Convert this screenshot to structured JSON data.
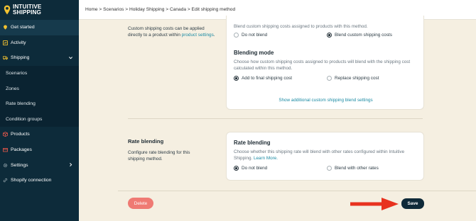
{
  "brand": {
    "line1": "INTUITIVE",
    "line2": "SHIPPING"
  },
  "colors": {
    "sidebar": "#0d2b3a",
    "accent_link": "#1a8aa3",
    "delete": "#ef7a73",
    "save": "#0f2a39",
    "arrow": "#e8321e",
    "background": "#f5efe1"
  },
  "breadcrumb": "Home > Scenarios > Holiday Shipping > Canada > Edit shipping method",
  "sidebar": {
    "items": [
      {
        "label": "Get started",
        "icon": "pin-icon"
      },
      {
        "label": "Activity",
        "icon": "activity-icon"
      },
      {
        "label": "Shipping",
        "icon": "truck-icon"
      },
      {
        "label": "Scenarios"
      },
      {
        "label": "Zones"
      },
      {
        "label": "Rate blending"
      },
      {
        "label": "Condition groups"
      },
      {
        "label": "Products",
        "icon": "box-icon"
      },
      {
        "label": "Packages",
        "icon": "package-icon"
      },
      {
        "label": "Settings",
        "icon": "gear-icon"
      },
      {
        "label": "Shopify connection",
        "icon": "link-icon"
      }
    ]
  },
  "custom_costs": {
    "desc_pre": "Custom shipping costs can be applied directly to a product within ",
    "desc_link": "product settings",
    "desc_post": ".",
    "card_text": "Blend custom shipping costs assigned to products with this method.",
    "opt_no": "Do not blend",
    "opt_yes": "Blend custom shipping costs",
    "mode_title": "Blending mode",
    "mode_text": "Choose how custom shipping costs assigned to products will blend with the shipping cost calculated within this method.",
    "mode_add": "Add to final shipping cost",
    "mode_replace": "Replace shipping cost",
    "show_link": "Show additional custom shipping blend settings"
  },
  "rate_blending": {
    "title": "Rate blending",
    "desc": "Configure rate blending for this shipping method.",
    "card_title": "Rate blending",
    "card_text": "Choose whether this shipping rate will blend with other rates configured within Intuitive Shipping.",
    "learn_more": "Learn More.",
    "opt_no": "Do not blend",
    "opt_yes": "Blend with other rates"
  },
  "actions": {
    "delete": "Delete",
    "save": "Save"
  }
}
